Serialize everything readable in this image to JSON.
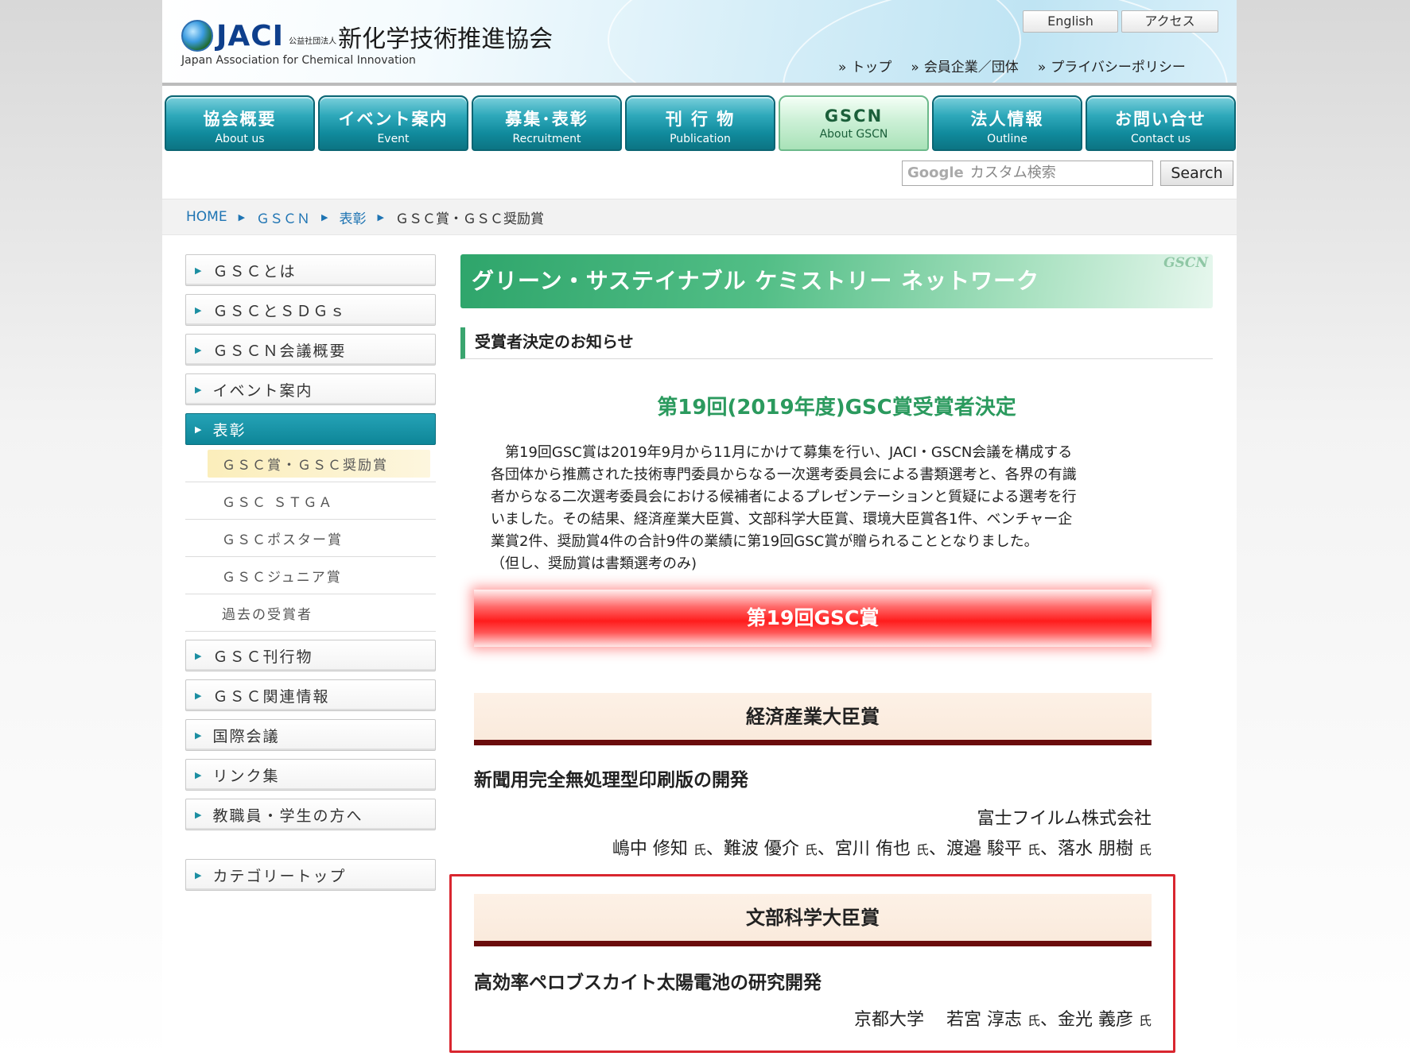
{
  "header": {
    "logo_jaci": "JACI",
    "logo_corp": "公益社団法人",
    "logo_name": "新化学技術推進協会",
    "logo_en": "Japan Association for Chemical Innovation",
    "btn_english": "English",
    "btn_access": "アクセス",
    "nav": [
      {
        "label": "トップ"
      },
      {
        "label": "会員企業／団体"
      },
      {
        "label": "プライバシーポリシー"
      }
    ],
    "nav_marker": "»"
  },
  "mainnav": [
    {
      "jp": "協会概要",
      "en": "About us"
    },
    {
      "jp": "イベント案内",
      "en": "Event"
    },
    {
      "jp": "募集･表彰",
      "en": "Recruitment"
    },
    {
      "jp": "刊 行 物",
      "en": "Publication"
    },
    {
      "jp": "GSCN",
      "en": "About GSCN"
    },
    {
      "jp": "法人情報",
      "en": "Outline"
    },
    {
      "jp": "お問い合せ",
      "en": "Contact us"
    }
  ],
  "search": {
    "google": "Google",
    "placeholder": "カスタム検索",
    "button": "Search"
  },
  "breadcrumb": {
    "home": "HOME",
    "gscn": "ＧＳＣＮ",
    "award": "表彰",
    "current": "ＧＳＣ賞・ＧＳＣ奨励賞"
  },
  "sidebar": {
    "items": [
      {
        "label": "ＧＳＣとは"
      },
      {
        "label": "ＧＳＣとＳＤＧｓ"
      },
      {
        "label": "ＧＳＣＮ会議概要"
      },
      {
        "label": "イベント案内"
      },
      {
        "label": "表彰"
      }
    ],
    "sub": [
      {
        "label": "ＧＳＣ賞・ＧＳＣ奨励賞"
      },
      {
        "label": "ＧＳＣ ＳＴＧＡ"
      },
      {
        "label": "ＧＳＣポスター賞"
      },
      {
        "label": "ＧＳＣジュニア賞"
      },
      {
        "label": "過去の受賞者"
      }
    ],
    "items2": [
      {
        "label": "ＧＳＣ刊行物"
      },
      {
        "label": "ＧＳＣ関連情報"
      },
      {
        "label": "国際会議"
      },
      {
        "label": "リンク集"
      },
      {
        "label": "教職員・学生の方へ"
      }
    ],
    "category_top": "カテゴリートップ"
  },
  "content": {
    "banner": "グリーン・サステイナブル ケミストリー ネットワーク",
    "banner_tag": "GSCN",
    "section_title": "受賞者決定のお知らせ",
    "headline": "第19回(2019年度)GSC賞受賞者決定",
    "intro_1": "第19回GSC賞は2019年9月から11月にかけて募集を行い、JACI・GSCN会議を構成する",
    "intro_2": "各団体から推薦された技術専門委員からなる一次選考委員会による書類選考と、各界の有識",
    "intro_3": "者からなる二次選考委員会における候補者によるプレゼンテーションと質疑による選考を行",
    "intro_4": "いました。その結果、経済産業大臣賞、文部科学大臣賞、環境大臣賞各1件、ベンチャー企",
    "intro_5": "業賞2件、奨励賞4件の合計9件の業績に第19回GSC賞が贈られることとなりました。",
    "intro_6": "（但し、奨励賞は書類選考のみ)",
    "award_banner": "第19回GSC賞",
    "honorific": "氏",
    "separator": "、",
    "award1": {
      "category": "経済産業大臣賞",
      "title": "新聞用完全無処理型印刷版の開発",
      "org": "富士フイルム株式会社",
      "names": [
        "嶋中 修知",
        "難波 優介",
        "宮川 侑也",
        "渡邉 駿平",
        "落水 朋樹"
      ]
    },
    "award2": {
      "category": "文部科学大臣賞",
      "title": "高効率ペロブスカイト太陽電池の研究開発",
      "org": "京都大学",
      "names": [
        "若宮 淳志",
        "金光 義彦"
      ]
    }
  }
}
